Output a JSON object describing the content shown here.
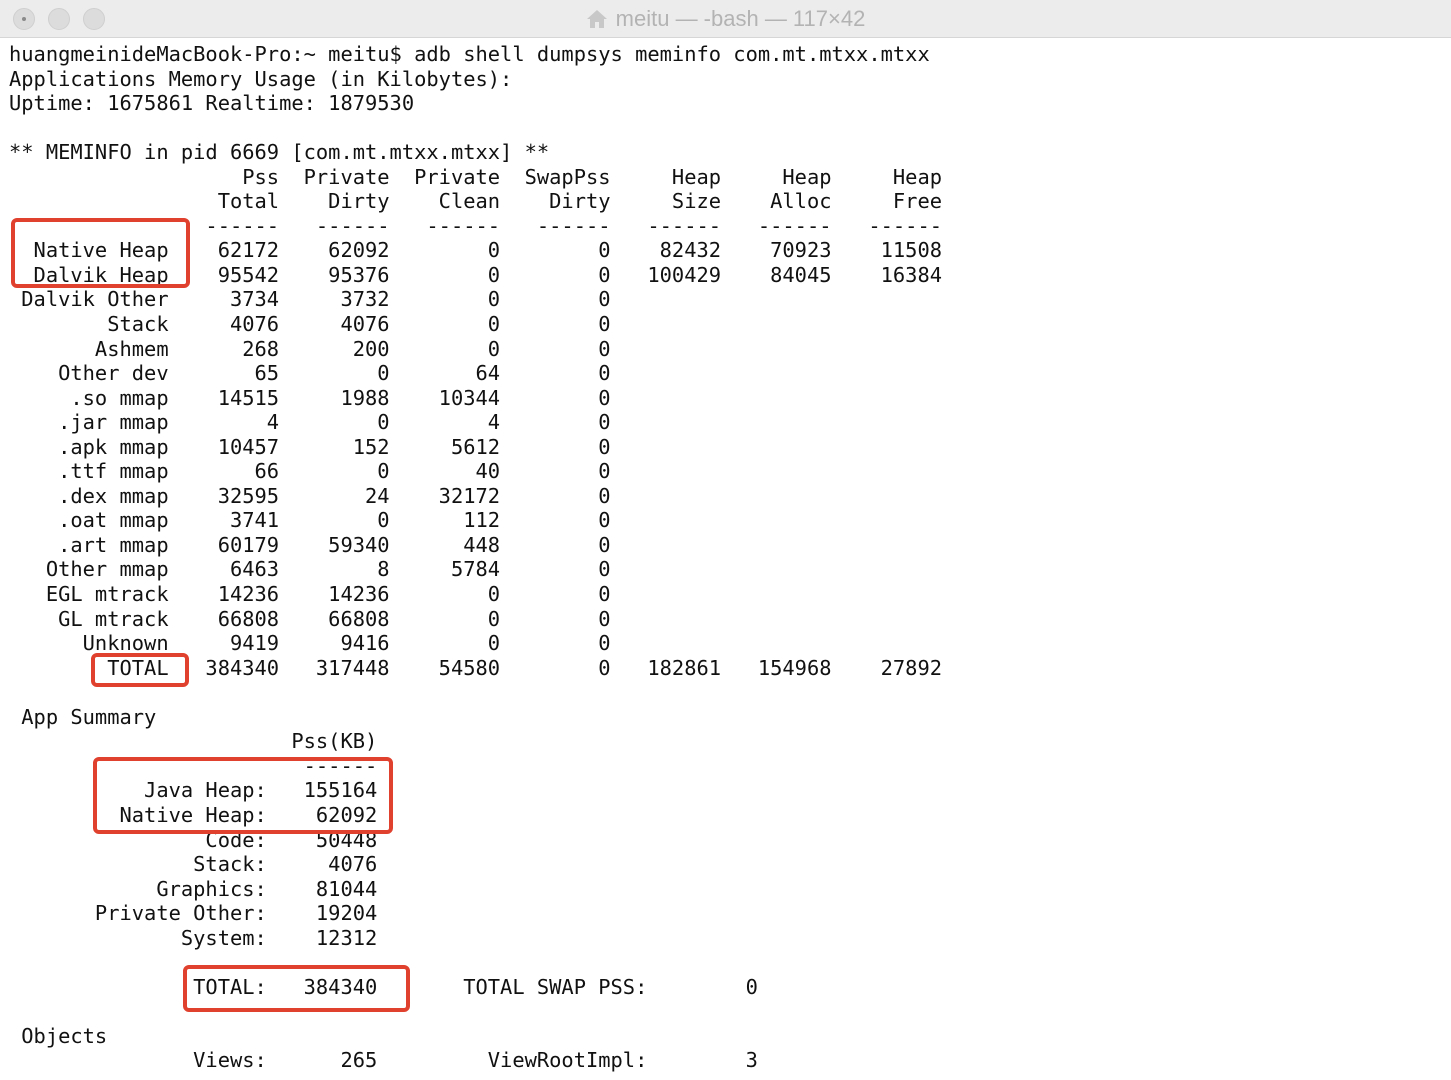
{
  "window": {
    "title": "meitu — -bash — 117×42",
    "title_icon": "home-icon",
    "buttons": [
      "close",
      "minimize",
      "zoom"
    ]
  },
  "colors": {
    "highlight": "#e0412f",
    "text": "#111111",
    "titlebar": "#ececec",
    "title_text": "#b3b3b3"
  },
  "terminal": {
    "lines": [
      "huangmeinideMacBook-Pro:~ meitu$ adb shell dumpsys meminfo com.mt.mtxx.mtxx",
      "Applications Memory Usage (in Kilobytes):",
      "Uptime: 1675861 Realtime: 1879530",
      "",
      "** MEMINFO in pid 6669 [com.mt.mtxx.mtxx] **",
      "                   Pss  Private  Private  SwapPss     Heap     Heap     Heap",
      "                 Total    Dirty    Clean    Dirty     Size    Alloc     Free",
      "                ------   ------   ------   ------   ------   ------   ------",
      "  Native Heap    62172    62092        0        0    82432    70923    11508",
      "  Dalvik Heap    95542    95376        0        0   100429    84045    16384",
      " Dalvik Other     3734     3732        0        0",
      "        Stack     4076     4076        0        0",
      "       Ashmem      268      200        0        0",
      "    Other dev       65        0       64        0",
      "     .so mmap    14515     1988    10344        0",
      "    .jar mmap        4        0        4        0",
      "    .apk mmap    10457      152     5612        0",
      "    .ttf mmap       66        0       40        0",
      "    .dex mmap    32595       24    32172        0",
      "    .oat mmap     3741        0      112        0",
      "    .art mmap    60179    59340      448        0",
      "   Other mmap     6463        8     5784        0",
      "   EGL mtrack    14236    14236        0        0",
      "    GL mtrack    66808    66808        0        0",
      "      Unknown     9419     9416        0        0",
      "        TOTAL   384340   317448    54580        0   182861   154968    27892",
      "",
      " App Summary",
      "                       Pss(KB)",
      "                        ------",
      "           Java Heap:   155164",
      "         Native Heap:    62092",
      "                Code:    50448",
      "               Stack:     4076",
      "            Graphics:    81044",
      "       Private Other:    19204",
      "              System:    12312",
      "",
      "               TOTAL:   384340       TOTAL SWAP PSS:        0",
      "",
      " Objects",
      "               Views:      265         ViewRootImpl:        3"
    ]
  }
}
